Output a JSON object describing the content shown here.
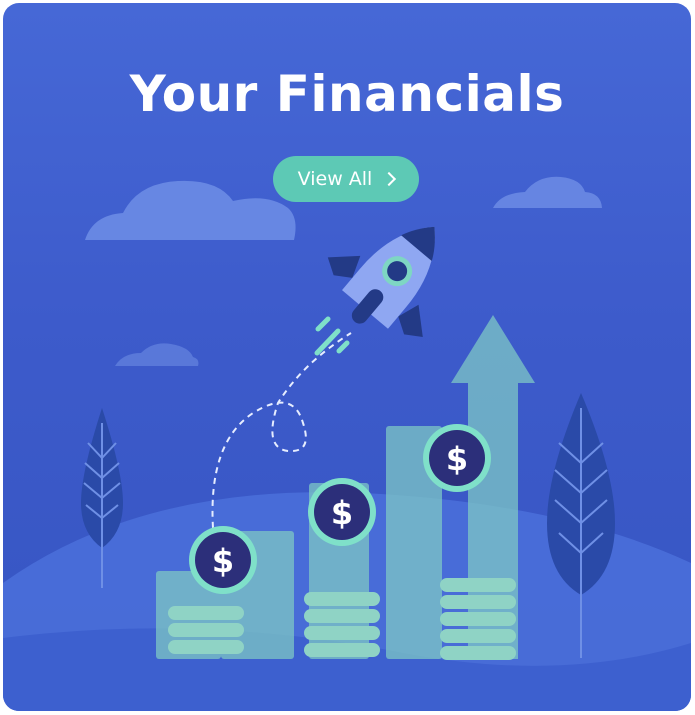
{
  "header": {
    "title": "Your Financials"
  },
  "actions": {
    "view_all_label": "View All"
  },
  "illustration": {
    "icons": [
      "rocket-icon",
      "dollar-coin-icon",
      "cloud-icon",
      "leaf-tree-icon",
      "up-arrow-icon",
      "coin-stack-icon"
    ],
    "coin_symbol": "$"
  },
  "colors": {
    "background": "#4268d4",
    "accent": "#5dc9b5",
    "coin_dark": "#2c2f7a",
    "bar": "#7ec7c5"
  }
}
